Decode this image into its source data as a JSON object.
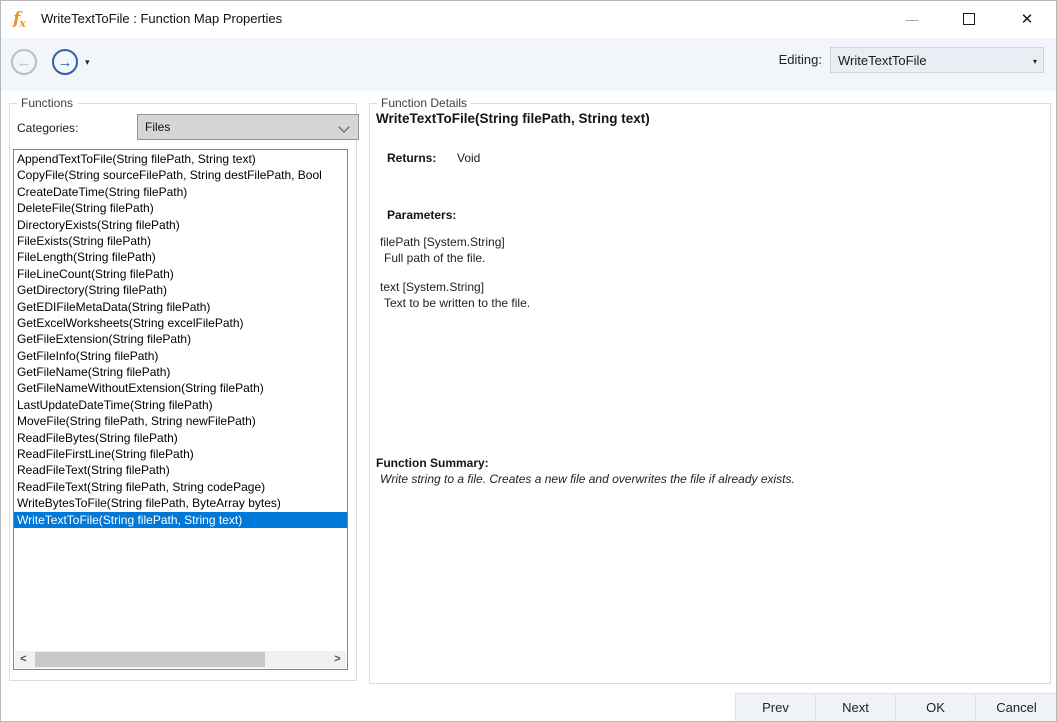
{
  "window": {
    "title": "WriteTextToFile : Function Map Properties",
    "icon_text": "f",
    "icon_sub": "x"
  },
  "icons": {
    "minimize": "—",
    "close": "✕",
    "back": "←",
    "forward": "→",
    "caret_down": "▾",
    "scroll_left": "<",
    "scroll_right": ">"
  },
  "toolbar": {
    "editing_label": "Editing:",
    "editing_value": "WriteTextToFile"
  },
  "functions_panel": {
    "title": "Functions",
    "categories_label": "Categories:",
    "categories_value": "Files",
    "selected_index": 22,
    "items": [
      "AppendTextToFile(String filePath, String text)",
      "CopyFile(String sourceFilePath, String destFilePath, Bool",
      "CreateDateTime(String filePath)",
      "DeleteFile(String filePath)",
      "DirectoryExists(String filePath)",
      "FileExists(String filePath)",
      "FileLength(String filePath)",
      "FileLineCount(String filePath)",
      "GetDirectory(String filePath)",
      "GetEDIFileMetaData(String filePath)",
      "GetExcelWorksheets(String excelFilePath)",
      "GetFileExtension(String filePath)",
      "GetFileInfo(String filePath)",
      "GetFileName(String filePath)",
      "GetFileNameWithoutExtension(String filePath)",
      "LastUpdateDateTime(String filePath)",
      "MoveFile(String filePath, String newFilePath)",
      "ReadFileBytes(String filePath)",
      "ReadFileFirstLine(String filePath)",
      "ReadFileText(String filePath)",
      "ReadFileText(String filePath, String codePage)",
      "WriteBytesToFile(String filePath, ByteArray bytes)",
      "WriteTextToFile(String filePath, String text)"
    ]
  },
  "details_panel": {
    "title": "Function Details",
    "signature": "WriteTextToFile(String filePath, String text)",
    "returns_label": "Returns:",
    "returns_value": "Void",
    "parameters_label": "Parameters:",
    "parameters": [
      {
        "name": "filePath [System.String]",
        "description": "Full path of the file."
      },
      {
        "name": "text [System.String]",
        "description": "Text to be written to the file."
      }
    ],
    "summary_label": "Function Summary:",
    "summary": "Write string to a file. Creates a new file and overwrites the file if already exists."
  },
  "footer": {
    "buttons": [
      "Prev",
      "Next",
      "OK",
      "Cancel"
    ]
  }
}
